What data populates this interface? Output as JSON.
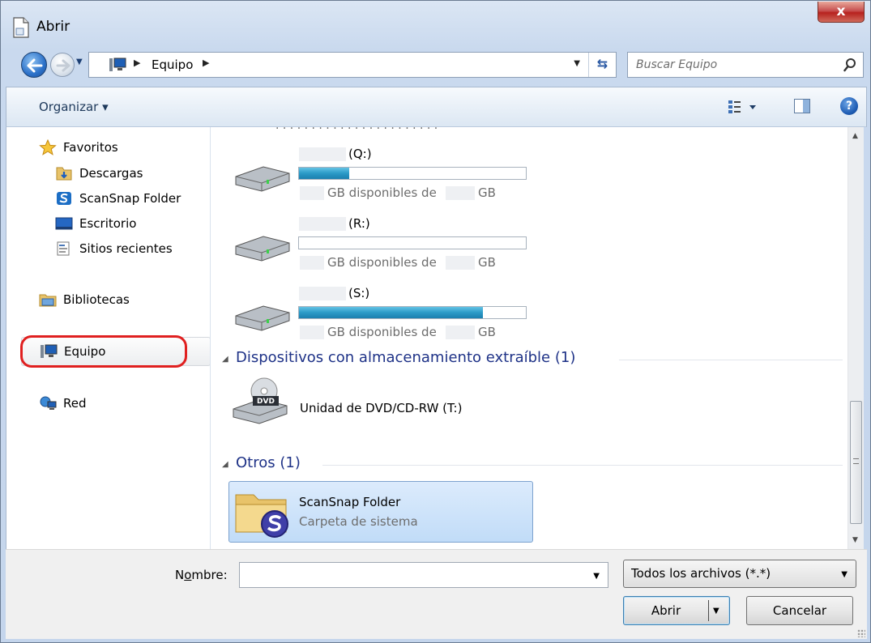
{
  "window": {
    "title": "Abrir",
    "close_label": "x"
  },
  "address": {
    "crumb": "Equipo",
    "search_placeholder": "Buscar Equipo"
  },
  "toolbar": {
    "organize_label": "Organizar ▾"
  },
  "nav": {
    "favorites_label": "Favoritos",
    "items": [
      {
        "label": "Descargas"
      },
      {
        "label": "ScanSnap Folder"
      },
      {
        "label": "Escritorio"
      },
      {
        "label": "Sitios recientes"
      }
    ],
    "libraries_label": "Bibliotecas",
    "computer_label": "Equipo",
    "network_label": "Red"
  },
  "content": {
    "drives": [
      {
        "letter": "(Q:)",
        "free_label": "GB disponibles de",
        "unit_label": "GB",
        "used_fraction": 0.22
      },
      {
        "letter": "(R:)",
        "free_label": "GB disponibles de",
        "unit_label": "GB",
        "used_fraction": 0.0
      },
      {
        "letter": "(S:)",
        "free_label": "GB disponibles de",
        "unit_label": "GB",
        "used_fraction": 0.81
      }
    ],
    "removable_header": "Dispositivos con almacenamiento extraíble (1)",
    "dvd_label": "Unidad de DVD/CD-RW (T:)",
    "dvd_badge": "DVD",
    "other_header": "Otros (1)",
    "folder": {
      "name": "ScanSnap Folder",
      "type": "Carpeta de sistema"
    }
  },
  "bottom": {
    "name_label_pre": "N",
    "name_label_u": "o",
    "name_label_post": "mbre:",
    "name_value": "",
    "filetype": "Todos los archivos (*.*)",
    "open_label": "Abrir",
    "cancel_label": "Cancelar"
  },
  "colors": {
    "selection_ring": "#e02020",
    "group_header": "#1e3287",
    "drive_bar": "#2b9ac7"
  }
}
